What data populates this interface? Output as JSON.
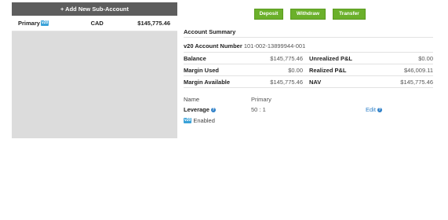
{
  "left": {
    "add_button": "+ Add New Sub-Account",
    "accounts": [
      {
        "name": "Primary",
        "badge": "v20",
        "currency": "CAD",
        "balance": "$145,775.46"
      }
    ]
  },
  "actions": {
    "deposit": "Deposit",
    "withdraw": "Withdraw",
    "transfer": "Transfer"
  },
  "summary": {
    "title": "Account Summary",
    "account_number_label": "v20 Account Number",
    "account_number": "101-002-13899944-001",
    "balance_label": "Balance",
    "balance": "$145,775.46",
    "unrealized_label": "Unrealized P&L",
    "unrealized": "$0.00",
    "margin_used_label": "Margin Used",
    "margin_used": "$0.00",
    "realized_label": "Realized P&L",
    "realized": "$46,009.11",
    "margin_available_label": "Margin Available",
    "margin_available": "$145,775.46",
    "nav_label": "NAV",
    "nav": "$145,775.46"
  },
  "details": {
    "name_label": "Name",
    "name": "Primary",
    "leverage_label": "Leverage",
    "leverage": "50 : 1",
    "edit_label": "Edit",
    "help_glyph": "?",
    "v20_badge": "v20",
    "enabled_label": "Enabled"
  },
  "colors": {
    "accent_green": "#6bb02b",
    "badge_blue": "#3aa2d8",
    "link_blue": "#2f80c8"
  }
}
